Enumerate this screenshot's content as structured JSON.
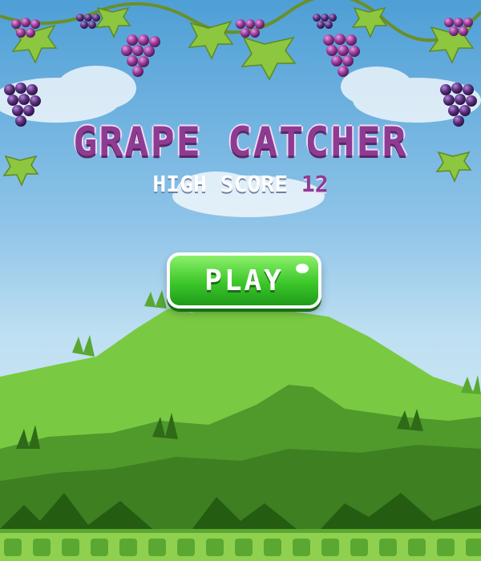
{
  "title": "GRAPE CATCHER",
  "high_score": {
    "label": "HIGH SCORE",
    "value": "12"
  },
  "play_button": {
    "label": "PLAY"
  },
  "colors": {
    "title": "#8e3c93",
    "button_green": "#3cc72a",
    "grape": "#7b2f86",
    "leaf": "#8dc63f"
  },
  "icons": [
    "grape-cluster-icon",
    "leaf-icon"
  ]
}
